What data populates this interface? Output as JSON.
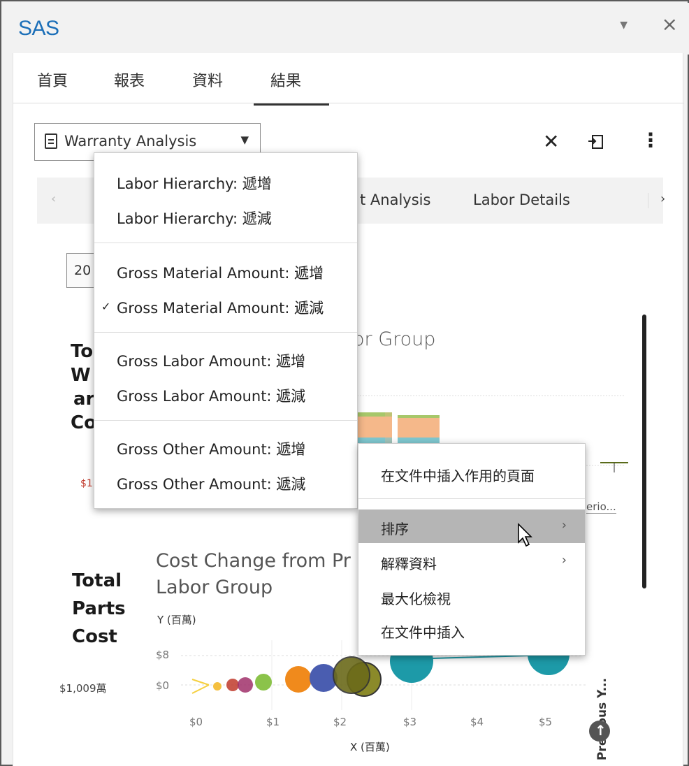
{
  "app": {
    "title": "SAS"
  },
  "tabs": [
    "首頁",
    "報表",
    "資料",
    "結果"
  ],
  "active_tab": "結果",
  "report_selector": {
    "value": "Warranty Analysis"
  },
  "page_tabs": {
    "labels": [
      "t Analysis",
      "Labor Details"
    ]
  },
  "year_filter": {
    "value": "20"
  },
  "kpi1": {
    "lines": [
      "To",
      "W",
      "ar",
      "Co"
    ],
    "value": "$1,6"
  },
  "chart1": {
    "title": "or Group",
    "partial_axis_labels": [
      "erio..."
    ],
    "colors": {
      "orange": "#f5b88a",
      "green": "#a7c76a",
      "teal": "#7fc7cf"
    }
  },
  "kpi2": {
    "lines": [
      "Total",
      "Parts",
      "Cost"
    ],
    "value": "$1,009萬"
  },
  "chart2": {
    "title_line1": "Cost Change from Pr",
    "title_line2": "Labor Group",
    "ylabel": "Y (百萬)",
    "xlabel": "X (百萬)",
    "y_ticks": [
      "$8",
      "$0"
    ],
    "x_ticks": [
      "$0",
      "$1",
      "$2",
      "$3",
      "$4",
      "$5"
    ]
  },
  "previous_year": {
    "label": "Previous Y..."
  },
  "sort_menu": {
    "groups": [
      [
        "Labor Hierarchy: 遞增",
        "Labor Hierarchy: 遞減"
      ],
      [
        "Gross Material Amount: 遞增",
        "Gross Material Amount: 遞減"
      ],
      [
        "Gross Labor Amount: 遞增",
        "Gross Labor Amount: 遞減"
      ],
      [
        "Gross Other Amount: 遞增",
        "Gross Other Amount: 遞減"
      ]
    ],
    "checked": "Gross Material Amount: 遞減"
  },
  "context_menu": {
    "items": [
      {
        "label": "在文件中插入作用的頁面",
        "submenu": false
      },
      {
        "label": "排序",
        "submenu": true,
        "highlighted": true
      },
      {
        "label": "解釋資料",
        "submenu": true
      },
      {
        "label": "最大化檢視",
        "submenu": false
      },
      {
        "label": "在文件中插入",
        "submenu": false
      }
    ]
  }
}
